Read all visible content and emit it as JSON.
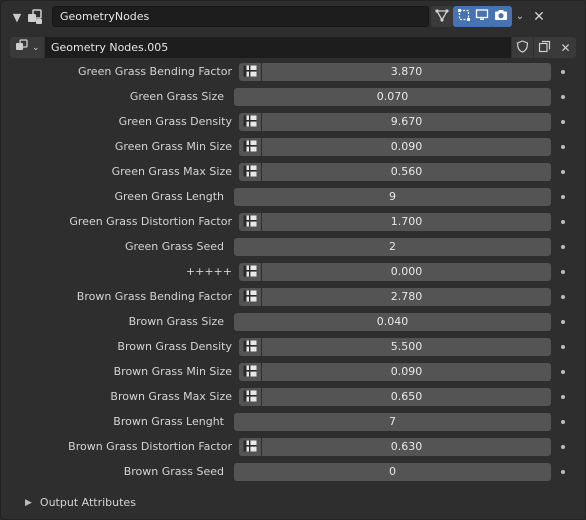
{
  "header": {
    "modifier_name": "GeometryNodes"
  },
  "node_group": {
    "name": "Geometry Nodes.005"
  },
  "properties": [
    {
      "label": "Green Grass Bending Factor",
      "value": "3.870",
      "has_attr_toggle": true
    },
    {
      "label": "Green Grass Size",
      "value": "0.070",
      "has_attr_toggle": false
    },
    {
      "label": "Green Grass Density",
      "value": "9.670",
      "has_attr_toggle": true
    },
    {
      "label": "Green Grass Min Size",
      "value": "0.090",
      "has_attr_toggle": true
    },
    {
      "label": "Green Grass Max Size",
      "value": "0.560",
      "has_attr_toggle": true
    },
    {
      "label": "Green Grass Length",
      "value": "9",
      "has_attr_toggle": false
    },
    {
      "label": "Green Grass Distortion Factor",
      "value": "1.700",
      "has_attr_toggle": true
    },
    {
      "label": "Green Grass Seed",
      "value": "2",
      "has_attr_toggle": false
    },
    {
      "label": "+++++",
      "value": "0.000",
      "has_attr_toggle": true
    },
    {
      "label": "Brown Grass Bending Factor",
      "value": "2.780",
      "has_attr_toggle": true
    },
    {
      "label": "Brown Grass Size",
      "value": "0.040",
      "has_attr_toggle": false
    },
    {
      "label": "Brown Grass Density",
      "value": "5.500",
      "has_attr_toggle": true
    },
    {
      "label": "Brown Grass Min Size",
      "value": "0.090",
      "has_attr_toggle": true
    },
    {
      "label": "Brown Grass Max Size",
      "value": "0.650",
      "has_attr_toggle": true
    },
    {
      "label": "Brown Grass Lenght",
      "value": "7",
      "has_attr_toggle": false
    },
    {
      "label": "Brown Grass Distortion  Factor",
      "value": "0.630",
      "has_attr_toggle": true
    },
    {
      "label": "Brown Grass Seed",
      "value": "0",
      "has_attr_toggle": false
    }
  ],
  "output_attributes": {
    "label": "Output Attributes"
  },
  "colors": {
    "panel_bg": "#2e2e2e",
    "field_bg": "#545454",
    "active_toggle": "#4772b3"
  }
}
